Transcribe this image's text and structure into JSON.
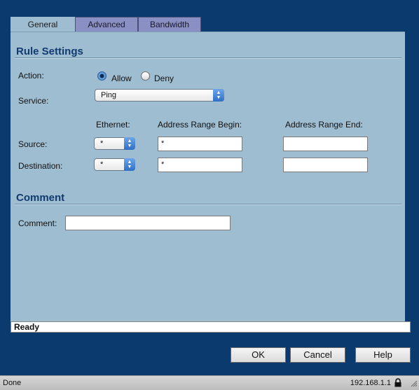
{
  "tabs": [
    {
      "label": "General",
      "active": true
    },
    {
      "label": "Advanced",
      "active": false
    },
    {
      "label": "Bandwidth",
      "active": false
    }
  ],
  "rule_settings": {
    "title": "Rule Settings",
    "action_label": "Action:",
    "allow_label": "Allow",
    "deny_label": "Deny",
    "selected_action": "Allow",
    "service_label": "Service:",
    "service_value": "Ping",
    "col_ethernet": "Ethernet:",
    "col_begin": "Address Range Begin:",
    "col_end": "Address Range End:",
    "source_label": "Source:",
    "destination_label": "Destination:",
    "source": {
      "ethernet": "*",
      "begin": "*",
      "end": ""
    },
    "destination": {
      "ethernet": "*",
      "begin": "*",
      "end": ""
    }
  },
  "comment_section": {
    "title": "Comment",
    "comment_label": "Comment:",
    "comment_value": ""
  },
  "status_text": "Ready",
  "buttons": {
    "ok": "OK",
    "cancel": "Cancel",
    "help": "Help"
  },
  "browser_status": {
    "left": "Done",
    "right": "192.168.1.1",
    "lock_icon": "lock-icon"
  },
  "colors": {
    "background": "#0b3a6e",
    "panel": "#9fbdd1",
    "heading": "#113a6e",
    "inactive_tab": "#8a8fc4"
  }
}
